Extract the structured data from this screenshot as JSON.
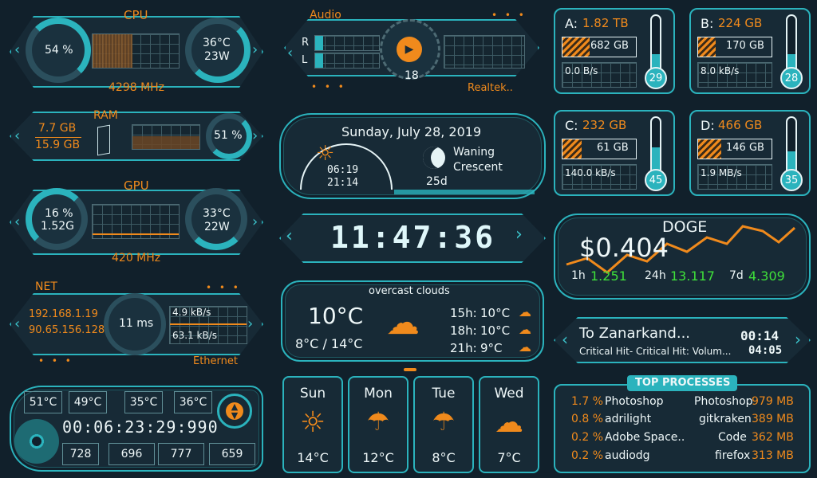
{
  "cpu": {
    "title": "CPU",
    "usage": "54 %",
    "temp": "36°C",
    "power": "23W",
    "freq": "4298 MHz"
  },
  "ram": {
    "title": "RAM",
    "used": "7.7 GB",
    "total": "15.9 GB",
    "pct": "51 %"
  },
  "gpu": {
    "title": "GPU",
    "usage": "16 %",
    "mem": "1.52G",
    "temp": "33°C",
    "power": "22W",
    "freq": "420 MHz"
  },
  "net": {
    "title": "NET",
    "ip_local": "192.168.1.19",
    "ip_public": "90.65.156.128",
    "ping": "11 ms",
    "up": "4.9 kB/s",
    "down": "63.1 kB/s",
    "adapter": "Ethernet"
  },
  "sensors": {
    "temps": [
      "51°C",
      "49°C",
      "35°C",
      "36°C"
    ],
    "uptime": "00:06:23:29:990",
    "values": [
      "728",
      "696",
      "777",
      "659"
    ]
  },
  "audio": {
    "title": "Audio",
    "r": "R",
    "l": "L",
    "volume": "18",
    "device": "Realtek.."
  },
  "date": {
    "text": "Sunday, July 28, 2019",
    "sunrise": "06:19",
    "sunset": "21:14",
    "moon": "Waning",
    "moon2": "Crescent",
    "moon_age": "25d"
  },
  "clock": {
    "time": "11:47:36"
  },
  "weather": {
    "desc": "overcast clouds",
    "temp": "10°C",
    "range": "8°C / 14°C",
    "hours": [
      {
        "t": "15h:",
        "v": "10°C"
      },
      {
        "t": "18h:",
        "v": "10°C"
      },
      {
        "t": "21h:",
        "v": "9°C"
      }
    ],
    "days": [
      {
        "name": "Sun",
        "temp": "14°C"
      },
      {
        "name": "Mon",
        "temp": "12°C"
      },
      {
        "name": "Tue",
        "temp": "8°C"
      },
      {
        "name": "Wed",
        "temp": "7°C"
      }
    ]
  },
  "drives": [
    {
      "letter": "A:",
      "size": "1.82 TB",
      "used": "682 GB",
      "speed": "0.0 B/s",
      "temp": "29",
      "fill": 0.37
    },
    {
      "letter": "B:",
      "size": "224 GB",
      "used": "170 GB",
      "speed": "8.0 kB/s",
      "temp": "28",
      "fill": 0.24
    },
    {
      "letter": "C:",
      "size": "232 GB",
      "used": "61 GB",
      "speed": "140.0 kB/s",
      "temp": "45",
      "fill": 0.26
    },
    {
      "letter": "D:",
      "size": "466 GB",
      "used": "146 GB",
      "speed": "1.9 MB/s",
      "temp": "35",
      "fill": 0.31
    }
  ],
  "crypto": {
    "name": "DOGE",
    "price": "$0.404",
    "h1_label": "1h",
    "h1": "1.251",
    "h24_label": "24h",
    "h24": "13.117",
    "d7_label": "7d",
    "d7": "4.309"
  },
  "music": {
    "title": "To Zanarkand...",
    "artist": "Critical Hit- Critical Hit: Volum...",
    "elapsed": "00:14",
    "total": "04:05"
  },
  "processes": {
    "title": "TOP PROCESSES",
    "cpu": [
      {
        "pct": "1.7 %",
        "name": "Photoshop"
      },
      {
        "pct": "0.8 %",
        "name": "adrilight"
      },
      {
        "pct": "0.2 %",
        "name": "Adobe Space.."
      },
      {
        "pct": "0.2 %",
        "name": "audiodg"
      }
    ],
    "mem": [
      {
        "name": "Photoshop",
        "size": "979 MB"
      },
      {
        "name": "gitkraken",
        "size": "389 MB"
      },
      {
        "name": "Code",
        "size": "362 MB"
      },
      {
        "name": "firefox",
        "size": "313 MB"
      }
    ]
  },
  "colors": {
    "accent": "#2bb3bd",
    "orange": "#f08a1c",
    "green": "#3fe03a",
    "bg": "#11202b"
  }
}
